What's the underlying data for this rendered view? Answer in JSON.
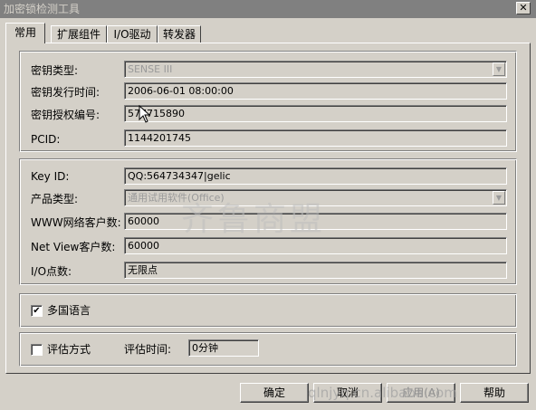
{
  "window": {
    "title": "加密锁检测工具",
    "close_glyph": "✕"
  },
  "tabs": [
    {
      "label": "常用"
    },
    {
      "label": "扩展组件"
    },
    {
      "label": "I/O驱动"
    },
    {
      "label": "转发器"
    }
  ],
  "key_info": {
    "type_label": "密钥类型:",
    "type_value": "SENSE III",
    "issue_time_label": "密钥发行时间:",
    "issue_time_value": "2006-06-01 08:00:00",
    "license_label": "密钥授权编号:",
    "license_value": "577715890",
    "pcid_label": "PCID:",
    "pcid_value": "1144201745"
  },
  "product_info": {
    "key_id_label": "Key ID:",
    "key_id_value": "QQ:564734347|gelic",
    "product_type_label": "产品类型:",
    "product_type_value": "通用试用软件(Office)",
    "www_clients_label": "WWW网络客户数:",
    "www_clients_value": "60000",
    "netview_clients_label": "Net View客户数:",
    "netview_clients_value": "60000",
    "io_points_label": "I/O点数:",
    "io_points_value": "无限点"
  },
  "multilang": {
    "label": "多国语言",
    "checked": true,
    "check_glyph": "✔"
  },
  "eval": {
    "label": "评估方式",
    "checked": false,
    "time_label": "评估时间:",
    "time_value": "0分钟"
  },
  "buttons": {
    "ok": "确定",
    "cancel": "取消",
    "apply": "应用(A)",
    "help": "帮助"
  },
  "watermark": {
    "text": "齐鲁商盟",
    "url": "qlnjyq.cn.alibaba.com"
  }
}
